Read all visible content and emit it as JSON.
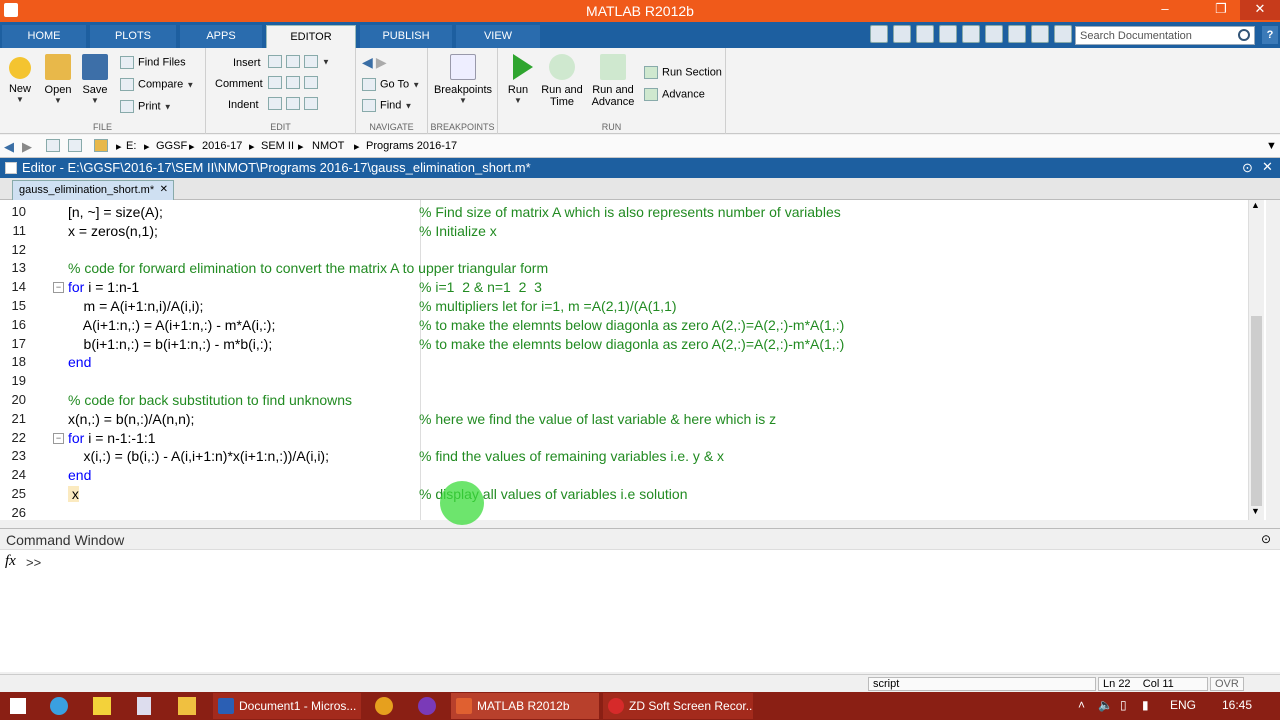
{
  "window": {
    "title": "MATLAB R2012b"
  },
  "ribbon_tabs": [
    "HOME",
    "PLOTS",
    "APPS",
    "EDITOR",
    "PUBLISH",
    "VIEW"
  ],
  "search": {
    "placeholder": "Search Documentation"
  },
  "file_group": {
    "label": "FILE",
    "new": "New",
    "open": "Open",
    "save": "Save",
    "find_files": "Find Files",
    "compare": "Compare",
    "print": "Print"
  },
  "edit_group": {
    "label": "EDIT",
    "insert": "Insert",
    "comment": "Comment",
    "indent": "Indent"
  },
  "navigate_group": {
    "label": "NAVIGATE",
    "go_to": "Go To",
    "find": "Find"
  },
  "breakpoints_group": {
    "label": "BREAKPOINTS",
    "breakpoints": "Breakpoints"
  },
  "run_group": {
    "label": "RUN",
    "run": "Run",
    "run_and_time_1": "Run and",
    "run_and_time_2": "Time",
    "run_and_advance_1": "Run and",
    "run_and_advance_2": "Advance",
    "run_section": "Run Section",
    "advance": "Advance"
  },
  "address": [
    "E:",
    "GGSF",
    "2016-17",
    "SEM II",
    "NMOT",
    "Programs 2016-17"
  ],
  "editor": {
    "title": "Editor - E:\\GGSF\\2016-17\\SEM II\\NMOT\\Programs 2016-17\\gauss_elimination_short.m*",
    "file_tab": "gauss_elimination_short.m*",
    "lines": [
      {
        "n": "10",
        "code": "[n, ~] = size(A);",
        "comment": "% Find size of matrix A which is also represents number of variables"
      },
      {
        "n": "11",
        "code": "x = zeros(n,1);",
        "comment": "% Initialize x"
      },
      {
        "n": "12",
        "code": "",
        "comment": ""
      },
      {
        "n": "13",
        "code": "% code for forward elimination to convert the matrix A to upper triangular form",
        "comment": ""
      },
      {
        "n": "14",
        "kw": "for",
        "code": " i = 1:n-1",
        "comment": "% i=1  2 & n=1  2  3"
      },
      {
        "n": "15",
        "code": "    m = A(i+1:n,i)/A(i,i);",
        "comment": "% multipliers let for i=1, m =A(2,1)/(A(1,1)"
      },
      {
        "n": "16",
        "code": "    A(i+1:n,:) = A(i+1:n,:) - m*A(i,:);",
        "comment": "% to make the elemnts below diagonla as zero A(2,:)=A(2,:)-m*A(1,:)"
      },
      {
        "n": "17",
        "code": "    b(i+1:n,:) = b(i+1:n,:) - m*b(i,:);",
        "comment": "% to make the elemnts below diagonla as zero A(2,:)=A(2,:)-m*A(1,:)"
      },
      {
        "n": "18",
        "kw": "end",
        "code": "",
        "comment": ""
      },
      {
        "n": "19",
        "code": "",
        "comment": ""
      },
      {
        "n": "20",
        "code": "% code for back substitution to find unknowns",
        "comment": ""
      },
      {
        "n": "21",
        "code": "x(n,:) = b(n,:)/A(n,n);",
        "comment": "% here we find the value of last variable & here which is z"
      },
      {
        "n": "22",
        "kw": "for",
        "code": " i = n-1:-1:1",
        "comment": ""
      },
      {
        "n": "23",
        "code": "    x(i,:) = (b(i,:) - A(i,i+1:n)*x(i+1:n,:))/A(i,i);",
        "comment": "% find the values of remaining variables i.e. y & x"
      },
      {
        "n": "24",
        "kw": "end",
        "code": "",
        "comment": ""
      },
      {
        "n": "25",
        "code": " x",
        "comment": "% display all values of variables i.e solution"
      },
      {
        "n": "26",
        "code": "",
        "comment": ""
      }
    ]
  },
  "command_window": {
    "title": "Command Window",
    "fx": "fx",
    "prompt": ">>"
  },
  "status": {
    "mode": "script",
    "ln_label": "Ln",
    "ln": "22",
    "col_label": "Col",
    "col": "11",
    "ovr": "OVR"
  },
  "taskbar": {
    "items": [
      "Document1 - Micros...",
      "MATLAB R2012b",
      "ZD Soft Screen Recor..."
    ],
    "lang": "ENG",
    "time": "16:45"
  },
  "colors": {
    "accent": "#1d5fa0",
    "title": "#f05a1a",
    "comment": "#228b22",
    "keyword": "#0000ff"
  }
}
